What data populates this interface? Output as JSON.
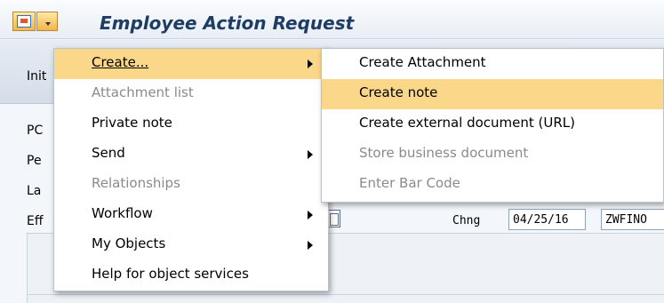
{
  "window": {
    "title": "Employee Action Request"
  },
  "toolbar": {
    "init_label": "Init"
  },
  "fields": {
    "labels": [
      "PC",
      "Pe",
      "La",
      "Eff"
    ],
    "chng_label": "Chng",
    "chng_date": "04/25/16",
    "chng_user": "ZWFINO"
  },
  "menu_main": {
    "items": [
      {
        "label": "Create...",
        "enabled": true,
        "submenu": true,
        "highlighted": true
      },
      {
        "label": "Attachment list",
        "enabled": false,
        "submenu": false
      },
      {
        "label": "Private note",
        "enabled": true,
        "submenu": false
      },
      {
        "label": "Send",
        "enabled": true,
        "submenu": true
      },
      {
        "label": "Relationships",
        "enabled": false,
        "submenu": false
      },
      {
        "label": "Workflow",
        "enabled": true,
        "submenu": true
      },
      {
        "label": "My Objects",
        "enabled": true,
        "submenu": true
      },
      {
        "label": "Help for object services",
        "enabled": true,
        "submenu": false
      }
    ]
  },
  "menu_create": {
    "items": [
      {
        "label": "Create Attachment",
        "enabled": true
      },
      {
        "label": "Create note",
        "enabled": true,
        "highlighted": true
      },
      {
        "label": "Create external document (URL)",
        "enabled": true
      },
      {
        "label": "Store business document",
        "enabled": false
      },
      {
        "label": "Enter Bar Code",
        "enabled": false
      }
    ]
  },
  "colors": {
    "highlight": "#fbd889",
    "title": "#1e3c64",
    "disabled": "#8a8a8a"
  }
}
